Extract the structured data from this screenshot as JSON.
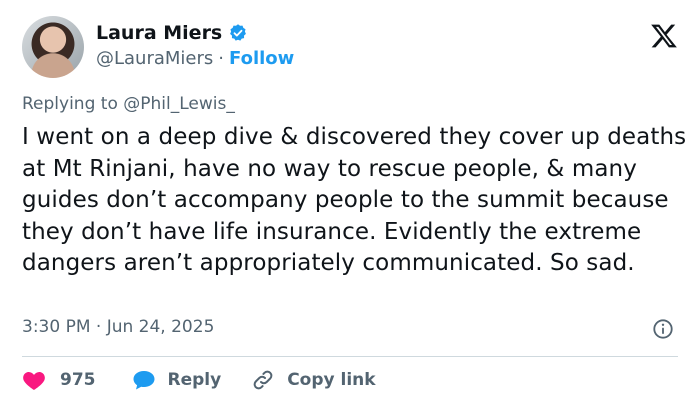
{
  "author": {
    "name": "Laura Miers",
    "handle": "@LauraMiers",
    "separator": "·",
    "follow_label": "Follow"
  },
  "reply_to": "Replying to @Phil_Lewis_",
  "tweet": {
    "text": "I went on a deep dive & discovered they cover up deaths at Mt Rinjani, have no way to rescue people, & many guides don’t accompany people to the summit because they don’t have life insurance. Evidently the extreme dangers aren’t appropriately communicated. So sad.",
    "timestamp": "3:30 PM · Jun 24, 2025"
  },
  "actions": {
    "like_count": "975",
    "reply_label": "Reply",
    "copy_label": "Copy link"
  },
  "icons": {
    "verified": "verified-badge-icon",
    "logo": "x-logo-icon",
    "info": "info-icon",
    "like": "heart-icon",
    "reply": "reply-bubble-icon",
    "copy": "link-icon"
  },
  "colors": {
    "accent": "#1d9bf0",
    "like": "#f91880",
    "text": "#0f1419",
    "muted": "#536471"
  }
}
